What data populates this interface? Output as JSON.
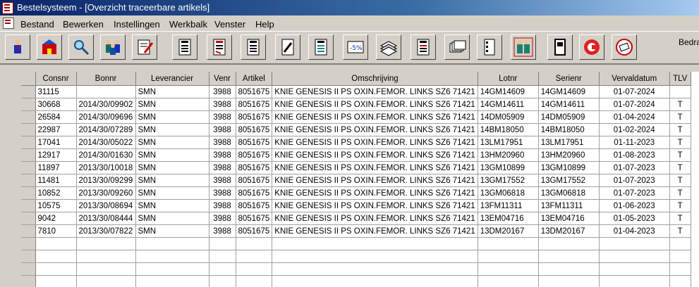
{
  "window": {
    "title": "Bestelsysteem - [Overzicht traceerbare artikels]"
  },
  "menu": [
    "Bestand",
    "Bewerken",
    "Instellingen",
    "Werkbalk",
    "Venster",
    "Help"
  ],
  "toolbar": {
    "buttons": [
      {
        "icon": "user-icon"
      },
      {
        "icon": "store-icon"
      },
      {
        "icon": "search-icon"
      },
      {
        "icon": "group-icon"
      },
      {
        "icon": "sign-document-icon"
      },
      {
        "icon": "order-document-icon"
      },
      {
        "icon": "document-zn-icon"
      },
      {
        "icon": "document-fsc-icon"
      },
      {
        "icon": "document-edit-icon"
      },
      {
        "icon": "document-cn-icon"
      },
      {
        "icon": "discount-icon"
      },
      {
        "icon": "books-icon"
      },
      {
        "icon": "document-tr-icon"
      },
      {
        "icon": "cards-icon"
      },
      {
        "icon": "list-icon"
      },
      {
        "icon": "team-icon"
      },
      {
        "icon": "device-icon"
      },
      {
        "icon": "exit-icon"
      },
      {
        "icon": "stamp-icon"
      }
    ],
    "right_label": "Bedra"
  },
  "table": {
    "columns": [
      "Consnr",
      "Bonnr",
      "Leverancier",
      "Venr",
      "Artikel",
      "Omschrijving",
      "Lotnr",
      "Serienr",
      "Vervaldatum",
      "TLV"
    ],
    "rows": [
      [
        "31115",
        "",
        "SMN",
        "3988",
        "8051675",
        "KNIE GENESIS II PS OXIN.FEMOR. LINKS SZ6 71421",
        "14GM14609",
        "14GM14609",
        "01-07-2024",
        ""
      ],
      [
        "30668",
        "2014/30/09902",
        "SMN",
        "3988",
        "8051675",
        "KNIE GENESIS II PS OXIN.FEMOR. LINKS SZ6 71421",
        "14GM14611",
        "14GM14611",
        "01-07-2024",
        "T"
      ],
      [
        "26584",
        "2014/30/09696",
        "SMN",
        "3988",
        "8051675",
        "KNIE GENESIS II PS OXIN.FEMOR. LINKS SZ6 71421",
        "14DM05909",
        "14DM05909",
        "01-04-2024",
        "T"
      ],
      [
        "22987",
        "2014/30/07289",
        "SMN",
        "3988",
        "8051675",
        "KNIE GENESIS II PS OXIN.FEMOR. LINKS SZ6 71421",
        "14BM18050",
        "14BM18050",
        "01-02-2024",
        "T"
      ],
      [
        "17041",
        "2014/30/05022",
        "SMN",
        "3988",
        "8051675",
        "KNIE GENESIS II PS OXIN.FEMOR. LINKS SZ6 71421",
        "13LM17951",
        "13LM17951",
        "01-11-2023",
        "T"
      ],
      [
        "12917",
        "2014/30/01630",
        "SMN",
        "3988",
        "8051675",
        "KNIE GENESIS II PS OXIN.FEMOR. LINKS SZ6 71421",
        "13HM20960",
        "13HM20960",
        "01-08-2023",
        "T"
      ],
      [
        "11897",
        "2013/30/10018",
        "SMN",
        "3988",
        "8051675",
        "KNIE GENESIS II PS OXIN.FEMOR. LINKS SZ6 71421",
        "13GM10899",
        "13GM10899",
        "01-07-2023",
        "T"
      ],
      [
        "11481",
        "2013/30/09299",
        "SMN",
        "3988",
        "8051675",
        "KNIE GENESIS II PS OXIN.FEMOR. LINKS SZ6 71421",
        "13GM17552",
        "13GM17552",
        "01-07-2023",
        "T"
      ],
      [
        "10852",
        "2013/30/09260",
        "SMN",
        "3988",
        "8051675",
        "KNIE GENESIS II PS OXIN.FEMOR. LINKS SZ6 71421",
        "13GM06818",
        "13GM06818",
        "01-07-2023",
        "T"
      ],
      [
        "10575",
        "2013/30/08694",
        "SMN",
        "3988",
        "8051675",
        "KNIE GENESIS II PS OXIN.FEMOR. LINKS SZ6 71421",
        "13FM11311",
        "13FM11311",
        "01-06-2023",
        "T"
      ],
      [
        "9042",
        "2013/30/08444",
        "SMN",
        "3988",
        "8051675",
        "KNIE GENESIS II PS OXIN.FEMOR. LINKS SZ6 71421",
        "13EM04716",
        "13EM04716",
        "01-05-2023",
        "T"
      ],
      [
        "7810",
        "2013/30/07822",
        "SMN",
        "3988",
        "8051675",
        "KNIE GENESIS II PS OXIN.FEMOR. LINKS SZ6 71421",
        "13DM20167",
        "13DM20167",
        "01-04-2023",
        "T"
      ]
    ],
    "empty_rows": 4
  },
  "colors": {
    "title_bar": "#0a246a",
    "window_face": "#d4d0c8",
    "grid_background": "#ffffff"
  }
}
